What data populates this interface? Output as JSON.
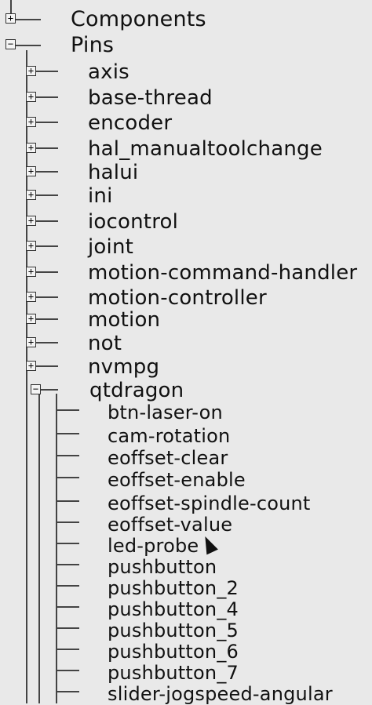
{
  "tree": {
    "components": {
      "label": "Components",
      "expander": "+"
    },
    "pins": {
      "label": "Pins",
      "expander": "−",
      "children": [
        {
          "label": "axis",
          "expander": "+"
        },
        {
          "label": "base-thread",
          "expander": "+"
        },
        {
          "label": "encoder",
          "expander": "+"
        },
        {
          "label": "hal_manualtoolchange",
          "expander": "+"
        },
        {
          "label": "halui",
          "expander": "+"
        },
        {
          "label": "ini",
          "expander": "+"
        },
        {
          "label": "iocontrol",
          "expander": "+"
        },
        {
          "label": "joint",
          "expander": "+"
        },
        {
          "label": "motion-command-handler",
          "expander": "+"
        },
        {
          "label": "motion-controller",
          "expander": "+"
        },
        {
          "label": "motion",
          "expander": "+"
        },
        {
          "label": "not",
          "expander": "+"
        },
        {
          "label": "nvmpg",
          "expander": "+"
        },
        {
          "label": "qtdragon",
          "expander": "−",
          "children": [
            "btn-laser-on",
            "cam-rotation",
            "eoffset-clear",
            "eoffset-enable",
            "eoffset-spindle-count",
            "eoffset-value",
            "led-probe",
            "pushbutton",
            "pushbutton_2",
            "pushbutton_4",
            "pushbutton_5",
            "pushbutton_6",
            "pushbutton_7",
            "slider-jogspeed-angular"
          ]
        }
      ]
    }
  }
}
